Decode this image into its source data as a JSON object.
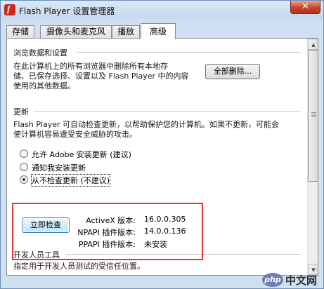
{
  "window": {
    "title": "Flash Player 设置管理器",
    "close_label": "✕"
  },
  "tabs": [
    {
      "label": "存储"
    },
    {
      "label": "摄像头和麦克风"
    },
    {
      "label": "播放"
    },
    {
      "label": "高级",
      "active": true
    }
  ],
  "browse": {
    "heading": "浏览数据和设置",
    "description_lines": [
      "在此计算机上的所有浏览器中删除所有本地存",
      "储、已保存选择、设置以及 Flash Player 中的内容",
      "使用的其他数据。"
    ],
    "delete_all_button": "全部删除..."
  },
  "updates": {
    "heading": "更新",
    "description_lines": [
      "Flash Player 可自动检查更新，以帮助保护您的计算机。如果不更新，可能会",
      "使计算机容易遭受安全威胁的攻击。"
    ],
    "options": [
      {
        "label": "允许 Adobe 安装更新 (建议)",
        "selected": false
      },
      {
        "label": "通知我安装更新",
        "selected": false
      },
      {
        "label": "从不检查更新 (不建议)",
        "selected": true
      }
    ],
    "check_now_button": "立即检查",
    "versions": [
      {
        "label": "ActiveX 版本:",
        "value": "16.0.0.305"
      },
      {
        "label": "NPAPI 插件版本:",
        "value": "14.0.0.136"
      },
      {
        "label": "PPAPI 插件版本:",
        "value": "未安装"
      }
    ]
  },
  "developer": {
    "heading": "开发人员工具",
    "description": "指定用于开发人员测试的受信任位置。"
  },
  "watermark": {
    "logo": "php",
    "text": "中文网"
  },
  "colors": {
    "highlight_border": "#e53935",
    "titlebar": "#cfe0f3",
    "close_button": "#c7432c"
  }
}
